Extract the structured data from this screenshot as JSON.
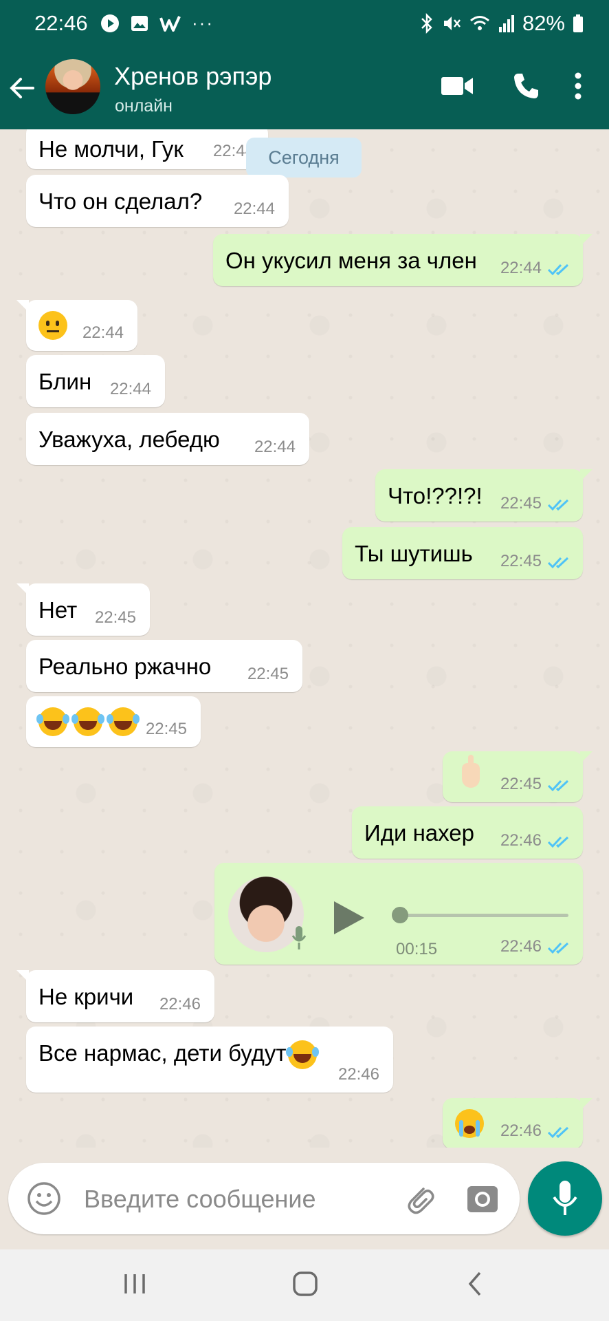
{
  "status_bar": {
    "time": "22:46",
    "battery": "82%",
    "more": "···"
  },
  "header": {
    "name": "Хренов рэпэр",
    "status": "онлайн"
  },
  "date_pill": "Сегодня",
  "messages": [
    {
      "dir": "in",
      "text": "Не молчи, Гук",
      "time": "22:44"
    },
    {
      "dir": "in",
      "text": "Что он сделал?",
      "time": "22:44"
    },
    {
      "dir": "out",
      "text": "Он укусил меня за член",
      "time": "22:44"
    },
    {
      "dir": "in",
      "text": "",
      "emoji": "neutral-face-emoji",
      "time": "22:44"
    },
    {
      "dir": "in",
      "text": "Блин",
      "time": "22:44"
    },
    {
      "dir": "in",
      "text": "Уважуха, лебедю",
      "time": "22:44"
    },
    {
      "dir": "out",
      "text": "Что!??!?!",
      "time": "22:45"
    },
    {
      "dir": "out",
      "text": "Ты шутишь",
      "time": "22:45"
    },
    {
      "dir": "in",
      "text": "Нет",
      "time": "22:45"
    },
    {
      "dir": "in",
      "text": "Реально ржачно",
      "time": "22:45"
    },
    {
      "dir": "in",
      "text": "",
      "emoji": "tears-of-joy-emoji",
      "time": "22:45"
    },
    {
      "dir": "out",
      "text": "",
      "emoji": "middle-finger-emoji",
      "time": "22:45"
    },
    {
      "dir": "out",
      "text": "Иди нахер",
      "time": "22:46"
    },
    {
      "dir": "out",
      "type": "voice",
      "duration": "00:15",
      "time": "22:46"
    },
    {
      "dir": "in",
      "text": "Не кричи",
      "time": "22:46"
    },
    {
      "dir": "in",
      "text": "Все нармас, дети будут",
      "emoji": "tears-of-joy-emoji",
      "time": "22:46"
    },
    {
      "dir": "out",
      "text": "",
      "emoji": "crying-face-emoji",
      "time": "22:46"
    }
  ],
  "composer": {
    "placeholder": "Введите сообщение"
  },
  "colors": {
    "header": "#075e54",
    "outgoing": "#dcf8c6",
    "incoming": "#ffffff",
    "chat_bg": "#ece5dd",
    "fab": "#00897b",
    "tick_blue": "#4fc3f7"
  }
}
